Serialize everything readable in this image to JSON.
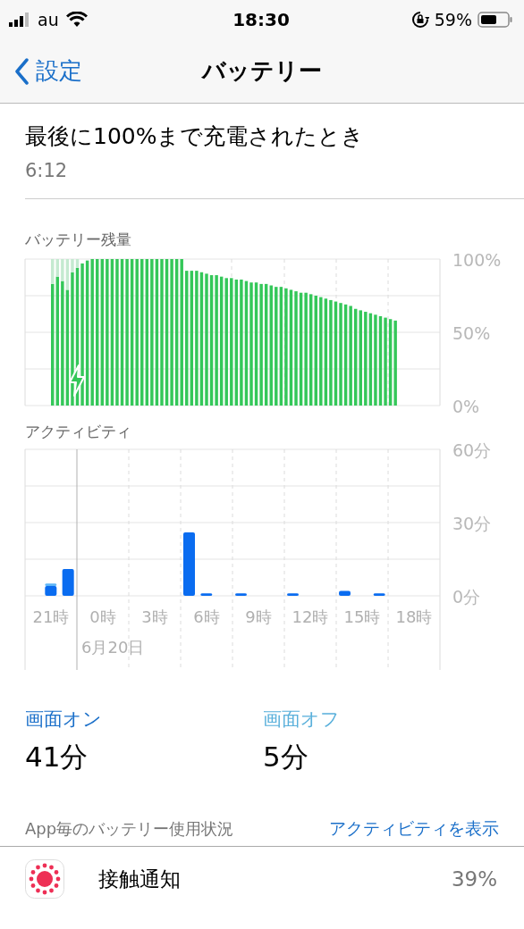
{
  "status_bar": {
    "carrier": "au",
    "time": "18:30",
    "battery_percent": "59%"
  },
  "nav": {
    "back": "設定",
    "title": "バッテリー"
  },
  "last_full_charge": {
    "label": "最後に100%まで充電されたとき",
    "time": "6:12"
  },
  "battery_level": {
    "chart_data": {
      "type": "bar",
      "title": "バッテリー残量",
      "stacked": true,
      "grid": true,
      "ylim": [
        0,
        100
      ],
      "yticks": [
        {
          "value": 0,
          "label": "0%"
        },
        {
          "value": 50,
          "label": "50%"
        },
        {
          "value": 100,
          "label": "100%"
        }
      ],
      "series": [
        {
          "color": "#34c759",
          "values": [
            83,
            88,
            85,
            79,
            91,
            94,
            97,
            99,
            100,
            100,
            100,
            100,
            100,
            100,
            100,
            100,
            100,
            100,
            100,
            100,
            100,
            100,
            100,
            100,
            100,
            100,
            100,
            92,
            92,
            92,
            91,
            90,
            89,
            89,
            88,
            87,
            87,
            86,
            86,
            85,
            84,
            84,
            83,
            83,
            82,
            81,
            81,
            80,
            79,
            78,
            77,
            77,
            76,
            75,
            74,
            73,
            72,
            71,
            70,
            69,
            68,
            66,
            65,
            64,
            63,
            62,
            61,
            60,
            59,
            58
          ]
        },
        {
          "color": "#c4ead0",
          "values": [
            17,
            12,
            15,
            21,
            9,
            6,
            null,
            null,
            null,
            null,
            null,
            null,
            null,
            null,
            null,
            null,
            null,
            null,
            null,
            null,
            null,
            null,
            null,
            null,
            null,
            null,
            null,
            null,
            null,
            null,
            null,
            null,
            null,
            null,
            null,
            null,
            null,
            null,
            null,
            null,
            null,
            null,
            null,
            null,
            null,
            null,
            null,
            null,
            null,
            null,
            null,
            null,
            null,
            null,
            null,
            null,
            null,
            null,
            null,
            null,
            null,
            null,
            null,
            null,
            null,
            null,
            null,
            null,
            null,
            null
          ]
        }
      ]
    }
  },
  "activity": {
    "chart_data": {
      "type": "bar",
      "title": "アクティビティ",
      "stacked": true,
      "ylim": [
        0,
        60
      ],
      "grid": true,
      "categories": [
        null,
        "21時",
        null,
        null,
        "0時",
        null,
        null,
        "3時",
        null,
        null,
        "6時",
        null,
        null,
        "9時",
        null,
        null,
        "12時",
        null,
        null,
        "15時",
        null,
        null,
        "18時",
        null
      ],
      "yticks": [
        {
          "value": 0,
          "label": "0分"
        },
        {
          "value": 30,
          "label": "30分"
        },
        {
          "value": 60,
          "label": "60分"
        }
      ],
      "series": [
        {
          "color": "#0a6cf0",
          "values": [
            0,
            4,
            11,
            0,
            0,
            0,
            0,
            0,
            0,
            26,
            1,
            0,
            1,
            0,
            0,
            1,
            0,
            0,
            2,
            0,
            1,
            0,
            0,
            0
          ]
        },
        {
          "color": "#5fb6f7",
          "values": [
            0,
            1,
            0,
            0,
            0,
            0,
            0,
            0,
            0,
            0,
            0,
            0,
            0,
            0,
            0,
            0,
            0,
            0,
            0,
            0,
            0,
            0,
            0,
            0
          ]
        }
      ]
    },
    "date_label": "6月20日"
  },
  "screen_time": [
    {
      "label": "画面オン",
      "value": "41分",
      "color": "#1a6fc9"
    },
    {
      "label": "画面オフ",
      "value": "5分",
      "color": "#5ab0db"
    }
  ],
  "app_usage": {
    "header": "App毎のバッテリー使用状況",
    "link": "アクティビティを表示",
    "apps": [
      {
        "name": "接触通知",
        "percent": "39%"
      }
    ]
  }
}
